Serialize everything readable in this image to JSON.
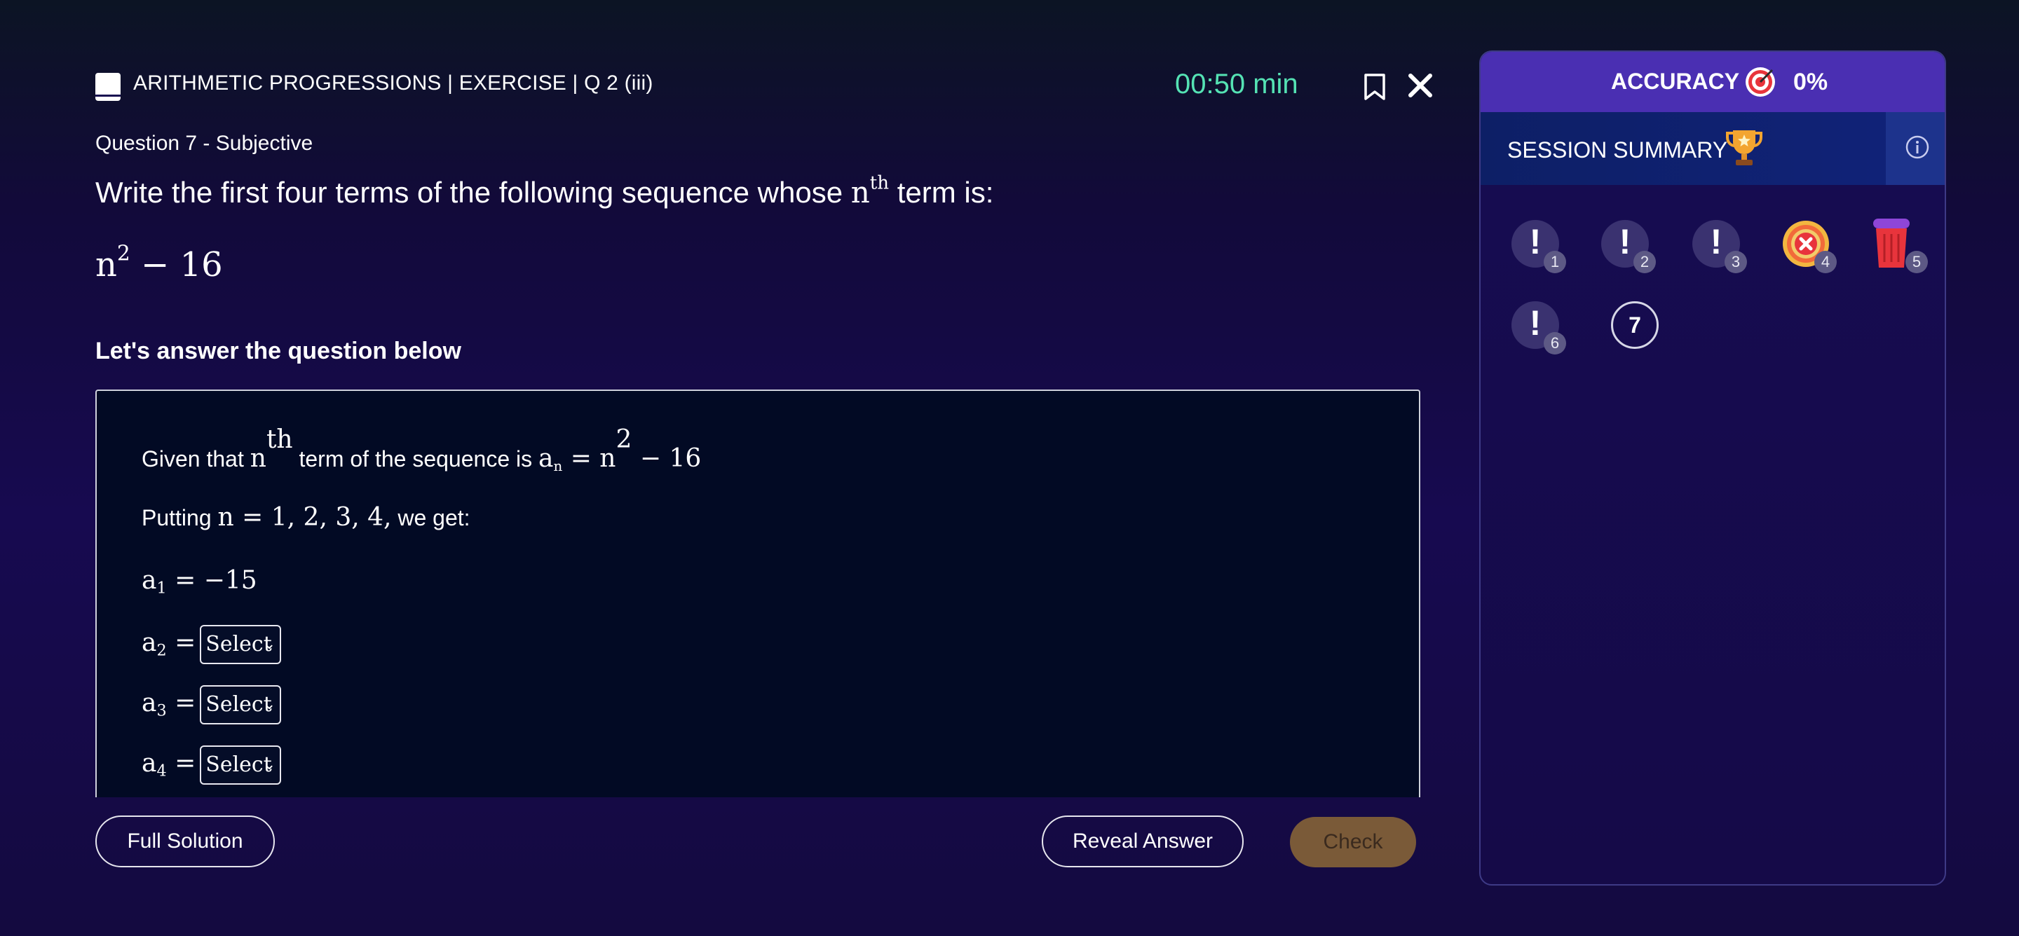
{
  "header": {
    "title": "ARITHMETIC PROGRESSIONS | EXERCISE | Q 2 (iii)",
    "timer": "00:50 min"
  },
  "question": {
    "type_label": "Question 7 - Subjective",
    "text_before": "Write the first four terms of the following sequence whose ",
    "nth_base": "n",
    "nth_sup": "th",
    "text_after": " term is:",
    "expr_base": "n",
    "expr_sup": "2",
    "expr_rest": " − 16"
  },
  "answer_prompt": "Let's answer the question below",
  "solution": {
    "given_prefix": "Given that ",
    "given_n": "n",
    "given_th": "th",
    "given_mid": " term of the sequence is ",
    "given_a": "a",
    "given_sub": "n",
    "given_eq": " = n",
    "given_sq": "2",
    "given_tail": " − 16",
    "putting_prefix": "Putting ",
    "putting_math": "n = 1, 2, 3, 4,",
    "putting_suffix": " we get:",
    "a1_var": "a",
    "a1_sub": "1",
    "a1_val": " = −15",
    "rows": [
      {
        "var": "a",
        "sub": "2",
        "eq": " =",
        "select_value": "Select"
      },
      {
        "var": "a",
        "sub": "3",
        "eq": " =",
        "select_value": "Select"
      },
      {
        "var": "a",
        "sub": "4",
        "eq": " =",
        "select_value": "Select"
      }
    ]
  },
  "buttons": {
    "full_solution": "Full Solution",
    "reveal_answer": "Reveal Answer",
    "check": "Check"
  },
  "panel": {
    "accuracy_label": "ACCURACY",
    "accuracy_value": "0%",
    "summary_label": "SESSION SUMMARY",
    "questions": [
      {
        "num": "1",
        "status": "skipped",
        "icon": "exclamation-icon"
      },
      {
        "num": "2",
        "status": "skipped",
        "icon": "exclamation-icon"
      },
      {
        "num": "3",
        "status": "skipped",
        "icon": "exclamation-icon"
      },
      {
        "num": "4",
        "status": "incorrect",
        "icon": "cross-target-icon"
      },
      {
        "num": "5",
        "status": "discarded",
        "icon": "trash-icon"
      },
      {
        "num": "6",
        "status": "skipped",
        "icon": "exclamation-icon"
      },
      {
        "num": "7",
        "status": "current"
      }
    ]
  },
  "colors": {
    "timer": "#55e3b4",
    "accuracy_bar": "#4a2fb2",
    "check_button": "#7a5a38"
  }
}
